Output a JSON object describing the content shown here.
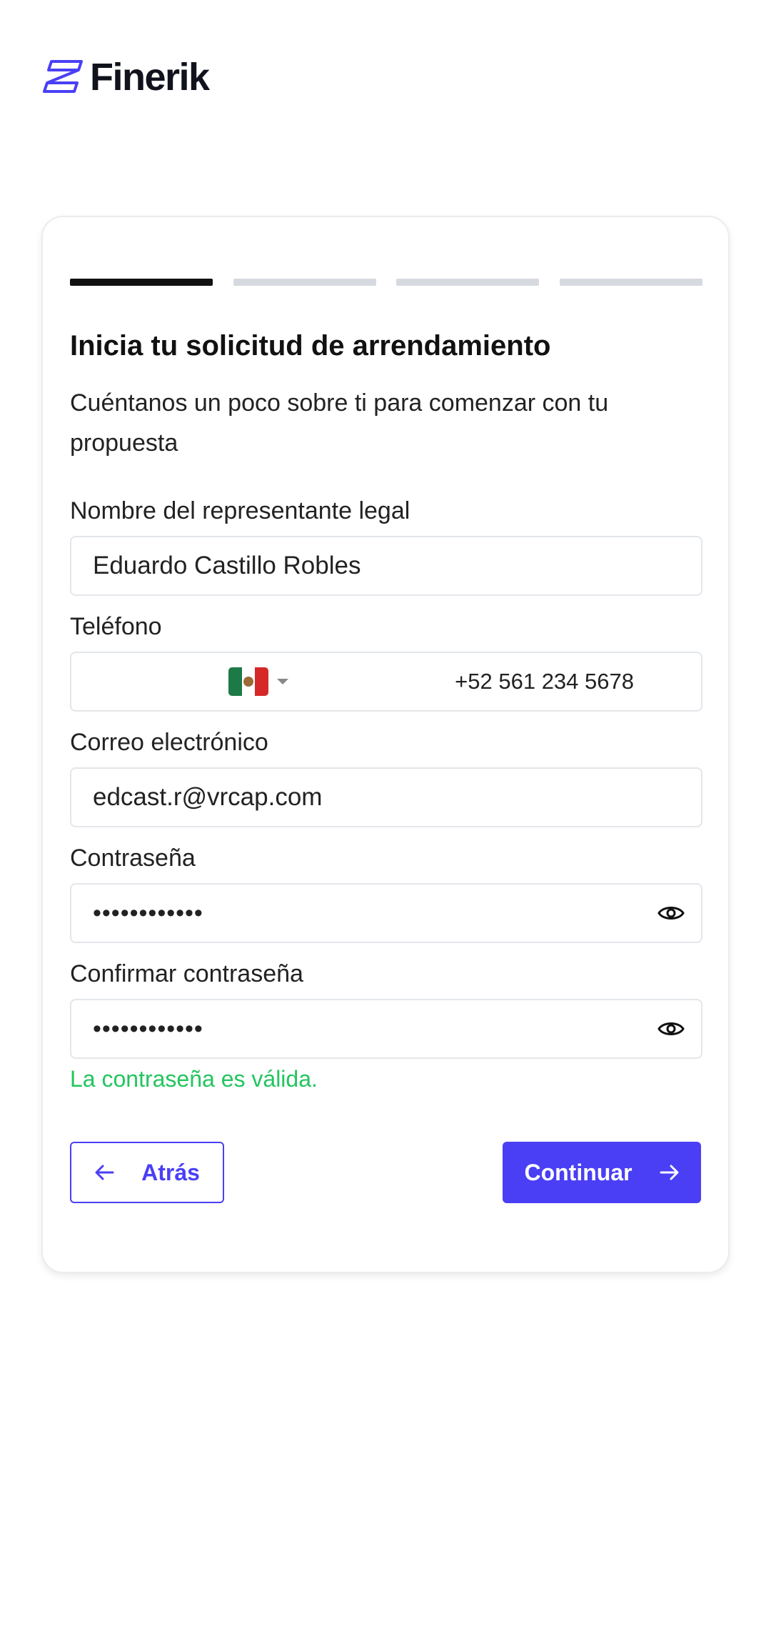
{
  "brand": {
    "name": "Finerik",
    "accent_color": "#4a3ff5"
  },
  "progress": {
    "total_steps": 4,
    "current_step": 1
  },
  "form": {
    "title": "Inicia tu solicitud de arrendamiento",
    "subtitle": "Cuéntanos un poco sobre ti para comenzar con tu propuesta",
    "legal_rep": {
      "label": "Nombre del representante legal",
      "value": "Eduardo Castillo Robles"
    },
    "phone": {
      "label": "Teléfono",
      "country_flag": "mexico-flag-icon",
      "value": "+52 561 234 5678"
    },
    "email": {
      "label": "Correo electrónico",
      "value": "edcast.r@vrcap.com"
    },
    "password": {
      "label": "Contraseña",
      "value": "••••••••••••"
    },
    "confirm_password": {
      "label": "Confirmar contraseña",
      "value": "••••••••••••"
    },
    "validation_message": "La contraseña es válida.",
    "validation_color": "#22c55e"
  },
  "actions": {
    "back_label": "Atrás",
    "continue_label": "Continuar"
  }
}
